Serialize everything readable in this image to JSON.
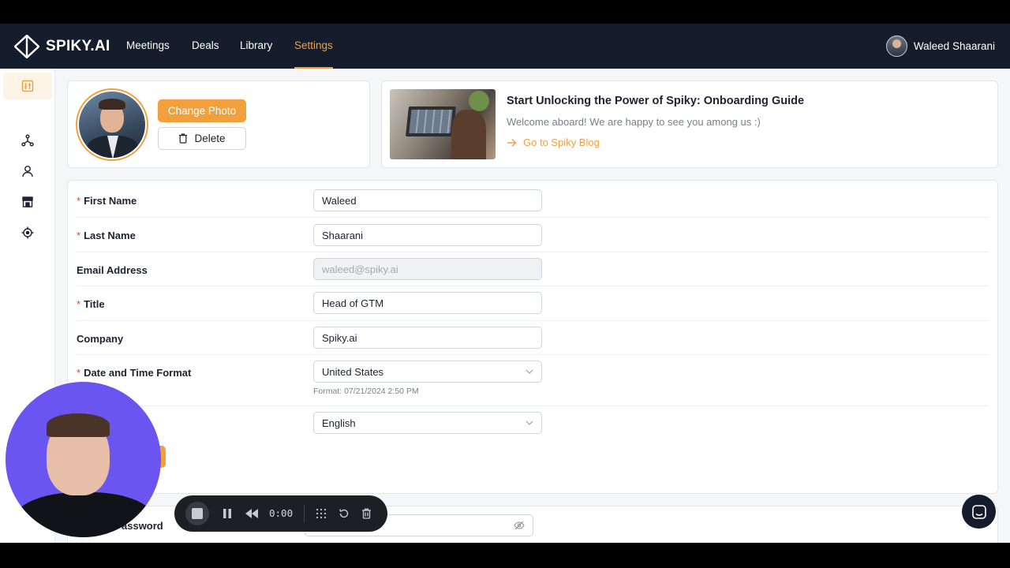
{
  "app": {
    "logo_text": "SPIKY.AI"
  },
  "nav": {
    "items": [
      {
        "label": "Meetings"
      },
      {
        "label": "Deals"
      },
      {
        "label": "Library"
      },
      {
        "label": "Settings",
        "active": true
      }
    ],
    "user_name": "Waleed Shaarani"
  },
  "sidebar": {
    "items": [
      {
        "icon": "sliders-icon",
        "active": true
      },
      {
        "icon": "network-icon"
      },
      {
        "icon": "user-icon"
      },
      {
        "icon": "store-icon"
      },
      {
        "icon": "target-icon"
      }
    ],
    "bottom_icon": "logout-icon"
  },
  "profile": {
    "change_photo_label": "Change Photo",
    "delete_label": "Delete"
  },
  "blog": {
    "title": "Start Unlocking the Power of Spiky: Onboarding Guide",
    "subtitle": "Welcome aboard! We are happy to see you among us :)",
    "link_label": "Go to Spiky Blog"
  },
  "form": {
    "first_name": {
      "label": "First Name",
      "value": "Waleed",
      "required": true
    },
    "last_name": {
      "label": "Last Name",
      "value": "Shaarani",
      "required": true
    },
    "email": {
      "label": "Email Address",
      "value": "waleed@spiky.ai",
      "required": false
    },
    "title": {
      "label": "Title",
      "value": "Head of GTM",
      "required": true
    },
    "company": {
      "label": "Company",
      "value": "Spiky.ai",
      "required": false
    },
    "date_format": {
      "label": "Date and Time Format",
      "value": "United States",
      "hint": "Format: 07/21/2024 2:50 PM",
      "required": true
    },
    "language": {
      "value": "English"
    },
    "password_label_partial": "assword"
  },
  "recorder": {
    "time": "0:00"
  },
  "colors": {
    "accent": "#f2a03d",
    "nav_bg": "#151c2b",
    "webcam_bg": "#6a55f0",
    "required": "#e2453c"
  }
}
